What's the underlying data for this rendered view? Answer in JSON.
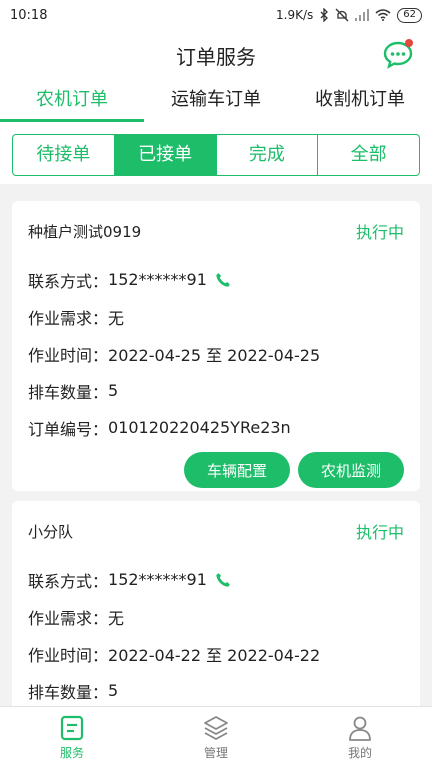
{
  "status_bar": {
    "time": "10:18",
    "net_speed": "1.9K/s",
    "battery": "62"
  },
  "header": {
    "title": "订单服务",
    "chat_icon": "chat-bubble-icon"
  },
  "top_tabs": [
    {
      "label": "农机订单",
      "active": true
    },
    {
      "label": "运输车订单",
      "active": false
    },
    {
      "label": "收割机订单",
      "active": false
    }
  ],
  "status_filter": [
    {
      "label": "待接单",
      "active": false
    },
    {
      "label": "已接单",
      "active": true
    },
    {
      "label": "完成",
      "active": false
    },
    {
      "label": "全部",
      "active": false
    }
  ],
  "orders": [
    {
      "name": "种植户测试0919",
      "status": "执行中",
      "contact_label": "联系方式：",
      "contact_value": "152******91",
      "demand_label": "作业需求：",
      "demand_value": "无",
      "time_label": "作业时间：",
      "time_value": "2022-04-25 至 2022-04-25",
      "count_label": "排车数量：",
      "count_value": "5",
      "order_no_label": "订单编号：",
      "order_no_value": "010120220425YRe23n",
      "btn_vehicle": "车辆配置",
      "btn_monitor": "农机监测"
    },
    {
      "name": "小分队",
      "status": "执行中",
      "contact_label": "联系方式：",
      "contact_value": "152******91",
      "demand_label": "作业需求：",
      "demand_value": "无",
      "time_label": "作业时间：",
      "time_value": "2022-04-22 至 2022-04-22",
      "count_label": "排车数量：",
      "count_value": "5"
    }
  ],
  "bottom_nav": [
    {
      "label": "服务",
      "icon": "service-icon",
      "active": true
    },
    {
      "label": "管理",
      "icon": "layers-icon",
      "active": false
    },
    {
      "label": "我的",
      "icon": "user-icon",
      "active": false
    }
  ],
  "colors": {
    "accent": "#1dbd6a",
    "background": "#f2f2f2",
    "badge": "#e8453c"
  }
}
